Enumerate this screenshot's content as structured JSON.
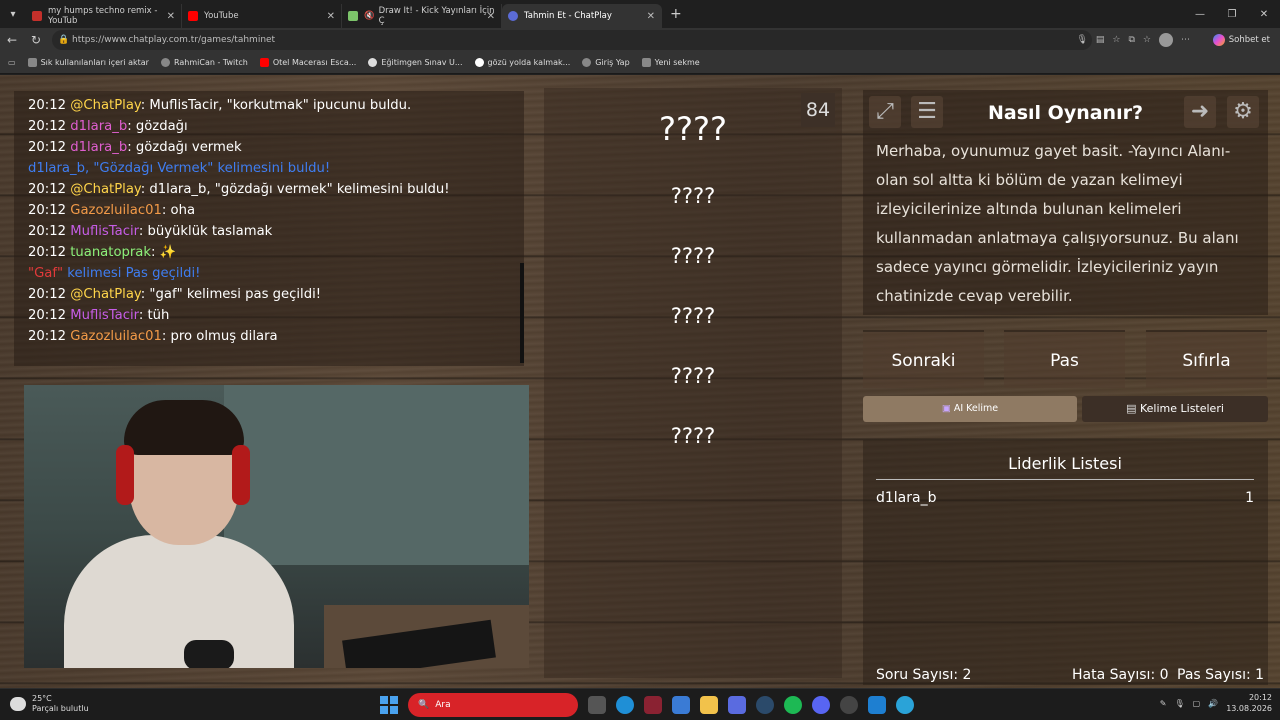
{
  "tabs": [
    {
      "title": "my humps techno remix - YouTub",
      "fav": "#c4302b",
      "active": false
    },
    {
      "title": "YouTube",
      "fav": "#ff0000",
      "active": false
    },
    {
      "title": "Draw It! - Kick Yayınları İçin Ç",
      "fav": "#7cc36a",
      "active": false
    },
    {
      "title": "Tahmin Et - ChatPlay",
      "fav": "#5b6bd6",
      "active": true
    }
  ],
  "address": {
    "url": "https://www.chatplay.com.tr/games/tahminet"
  },
  "browser": {
    "copilot_label": "Sohbet et"
  },
  "bookmarks": [
    {
      "label": "Sık kullanılanları içeri aktar"
    },
    {
      "label": "RahmiCan - Twitch"
    },
    {
      "label": "Otel Macerası Esca..."
    },
    {
      "label": "Eğitimgen Sınav U..."
    },
    {
      "label": "gözü yolda kalmak..."
    },
    {
      "label": "Giriş Yap"
    },
    {
      "label": "Yeni sekme"
    }
  ],
  "chat": [
    {
      "time": "20:12",
      "user": "@ChatPlay",
      "user_color": "#ffd54a",
      "sep": ": ",
      "text": "MuflisTacir, \"korkutmak\" ipucunu buldu.",
      "text_color": "#ffffff"
    },
    {
      "time": "20:12",
      "user": "d1lara_b",
      "user_color": "#e05fd0",
      "sep": ": ",
      "text": "gözdağı",
      "text_color": "#ffffff"
    },
    {
      "time": "20:12",
      "user": "d1lara_b",
      "user_color": "#e05fd0",
      "sep": ": ",
      "text": "gözdağı vermek",
      "text_color": "#ffffff"
    },
    {
      "time": "",
      "user": "d1lara_b, ",
      "user_color": "#3f7df0",
      "sep": "",
      "text": "\"Gözdağı Vermek\" kelimesini buldu!",
      "text_color": "#3f7df0"
    },
    {
      "time": "20:12",
      "user": "@ChatPlay",
      "user_color": "#ffd54a",
      "sep": ": ",
      "text": "d1lara_b, \"gözdağı vermek\" kelimesini buldu!",
      "text_color": "#ffffff"
    },
    {
      "time": "20:12",
      "user": "Gazozluilac01",
      "user_color": "#f29a48",
      "sep": ": ",
      "text": "oha",
      "text_color": "#ffffff"
    },
    {
      "time": "20:12",
      "user": "MuflisTacir",
      "user_color": "#c65de6",
      "sep": ": ",
      "text": "büyüklük taslamak",
      "text_color": "#ffffff"
    },
    {
      "time": "20:12",
      "user": "tuanatoprak",
      "user_color": "#8cf07a",
      "sep": ": ",
      "text": "✨",
      "text_color": "#ffffff"
    },
    {
      "time": "",
      "user": "\"Gaf\"",
      "user_color": "#e23a3a",
      "sep": " ",
      "text": "kelimesi Pas geçildi!",
      "text_color": "#3f7df0"
    },
    {
      "time": "20:12",
      "user": "@ChatPlay",
      "user_color": "#ffd54a",
      "sep": ": ",
      "text": "\"gaf\" kelimesi pas geçildi!",
      "text_color": "#ffffff"
    },
    {
      "time": "20:12",
      "user": "MuflisTacir",
      "user_color": "#c65de6",
      "sep": ": ",
      "text": "tüh",
      "text_color": "#ffffff"
    },
    {
      "time": "20:12",
      "user": "Gazozluilac01",
      "user_color": "#f29a48",
      "sep": ": ",
      "text": "pro olmuş dilara",
      "text_color": "#ffffff"
    }
  ],
  "game": {
    "timer": "84",
    "words": [
      "????",
      "????",
      "????",
      "????",
      "????",
      "????"
    ]
  },
  "info": {
    "title": "Nasıl Oynanır?",
    "text": "Merhaba, oyunumuz gayet basit. -Yayıncı Alanı- olan sol altta ki bölüm de yazan kelimeyi izleyicilerinize altında bulunan kelimeleri kullanmadan anlatmaya çalışıyorsunuz. Bu alanı sadece yayıncı görmelidir. İzleyicileriniz yayın chatinizde cevap verebilir."
  },
  "actions": {
    "next": "Sonraki",
    "pass": "Pas",
    "reset": "Sıfırla"
  },
  "subtabs": {
    "ai": "AI Kelime",
    "lists": "Kelime Listeleri"
  },
  "leaderboard": {
    "title": "Liderlik Listesi",
    "rows": [
      {
        "name": "d1lara_b",
        "score": "1"
      }
    ]
  },
  "stats": {
    "questions": "Soru Sayısı: 2",
    "errors": "Hata Sayısı: 0",
    "passes": "Pas Sayısı: 1"
  },
  "taskbar": {
    "temp": "25°C",
    "weather": "Parçalı bulutlu",
    "search": "Ara",
    "time": "20:12",
    "date": "13.08.2026"
  }
}
